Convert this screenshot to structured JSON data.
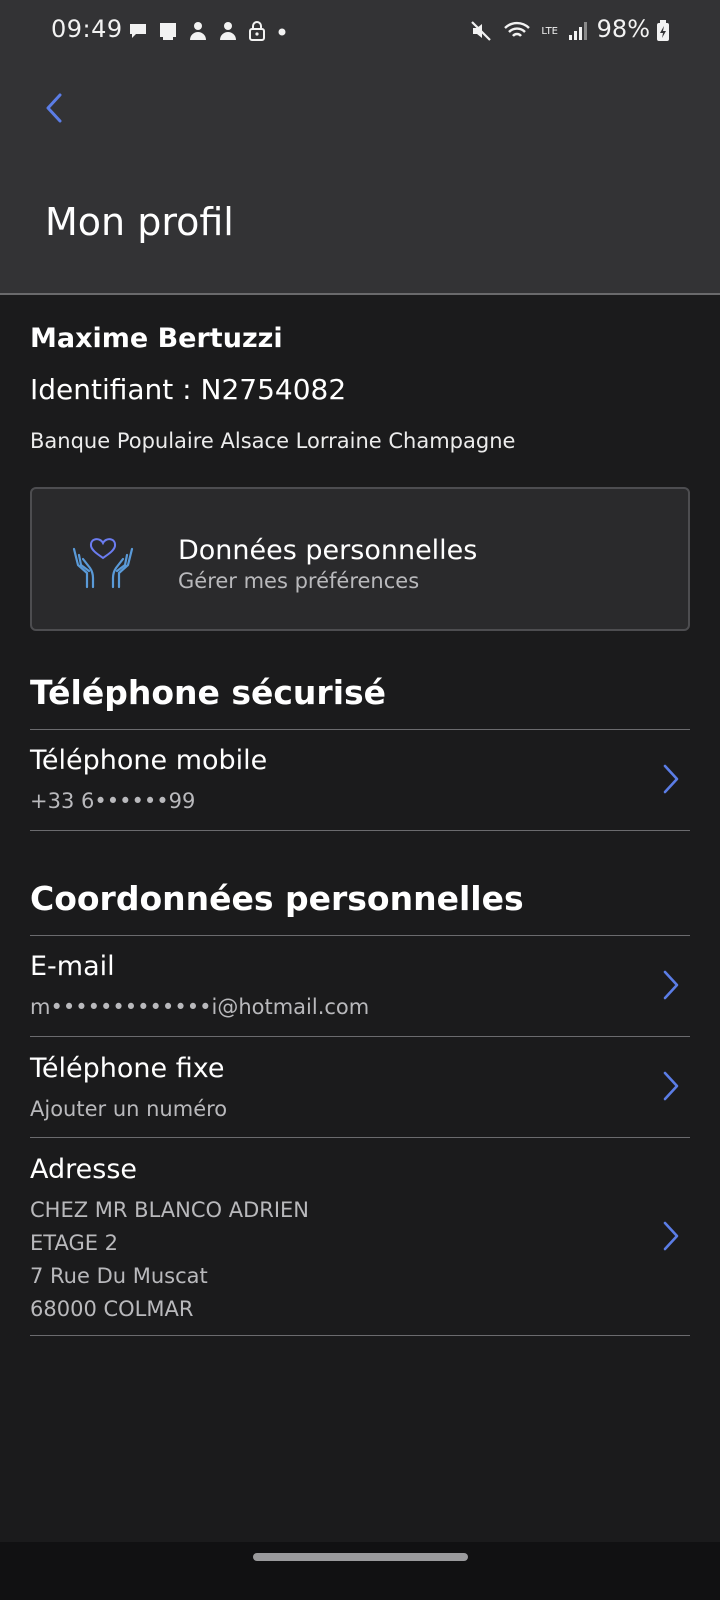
{
  "status_bar": {
    "time": "09:49",
    "battery": "98%",
    "network_label": "LTE"
  },
  "header": {
    "title": "Mon profil"
  },
  "profile": {
    "name": "Maxime Bertuzzi",
    "identifier": "Identifiant : N2754082",
    "bank": "Banque Populaire Alsace Lorraine Champagne"
  },
  "personal_data_card": {
    "title": "Données personnelles",
    "subtitle": "Gérer mes préférences",
    "icon": "hands-heart-icon"
  },
  "secure_phone": {
    "section_title": "Téléphone sécurisé",
    "mobile_label": "Téléphone mobile",
    "mobile_value": "+33 6••••••99"
  },
  "contact": {
    "section_title": "Coordonnées personnelles",
    "email_label": "E-mail",
    "email_value": "m•••••••••••••i@hotmail.com",
    "landline_label": "Téléphone fixe",
    "landline_value": "Ajouter un numéro",
    "address_label": "Adresse",
    "address_lines": [
      "CHEZ MR BLANCO ADRIEN",
      "ETAGE 2",
      "7 Rue Du Muscat",
      "68000 COLMAR"
    ]
  },
  "colors": {
    "accent": "#5b7de6",
    "header_bg": "#333335",
    "page_bg": "#1b1b1c",
    "card_bg": "#2a2a2c",
    "icon_blue": "#5a9ad8"
  }
}
